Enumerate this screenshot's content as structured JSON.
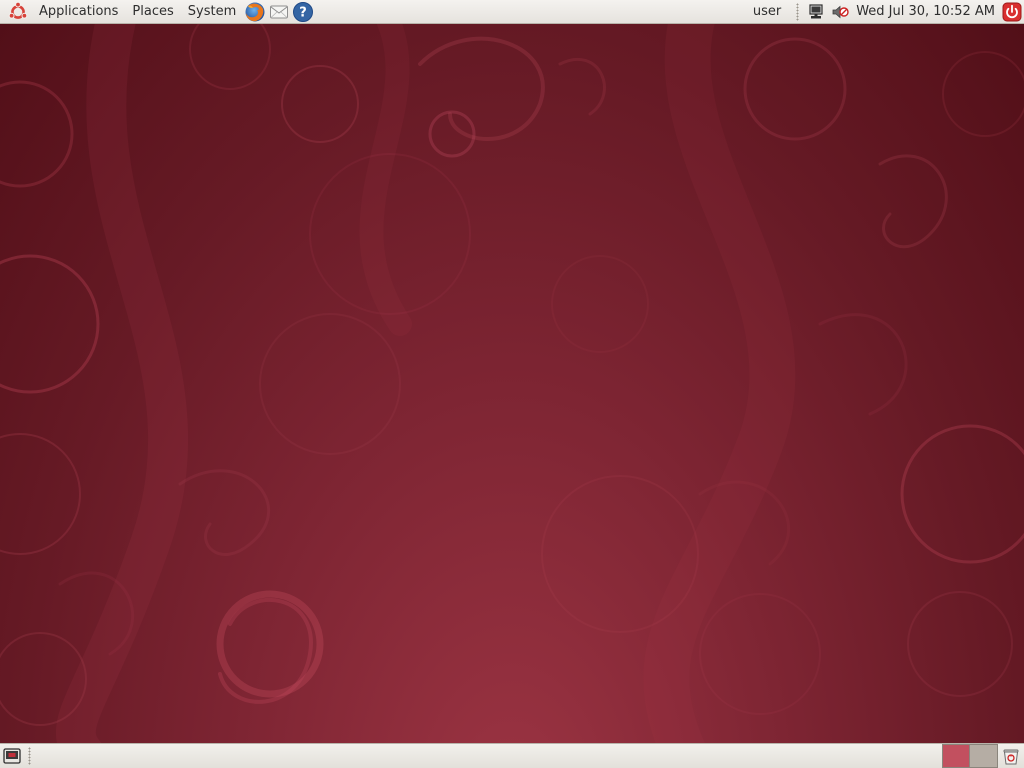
{
  "top_panel": {
    "menus": {
      "applications": "Applications",
      "places": "Places",
      "system": "System"
    },
    "launchers": [
      {
        "icon": "firefox-icon"
      },
      {
        "icon": "mail-icon"
      },
      {
        "icon": "help-icon"
      }
    ],
    "user": "user",
    "clock": "Wed Jul 30, 10:52 AM",
    "tray_icons": [
      "network-icon",
      "volume-muted-icon"
    ],
    "power_icon": "power-icon"
  },
  "bottom_panel": {
    "show_desktop_icon": "show-desktop-icon",
    "workspaces": [
      {
        "active": true,
        "color": "#c2505f"
      },
      {
        "active": false,
        "color": "#b5ada4"
      }
    ],
    "trash_icon": "trash-icon"
  },
  "theme": {
    "panel_bg": "#ebe9e5",
    "wallpaper_light": "#9c3443",
    "wallpaper_dark": "#520f18",
    "logo_color": "#d7433a",
    "power_color": "#d92f2f"
  }
}
